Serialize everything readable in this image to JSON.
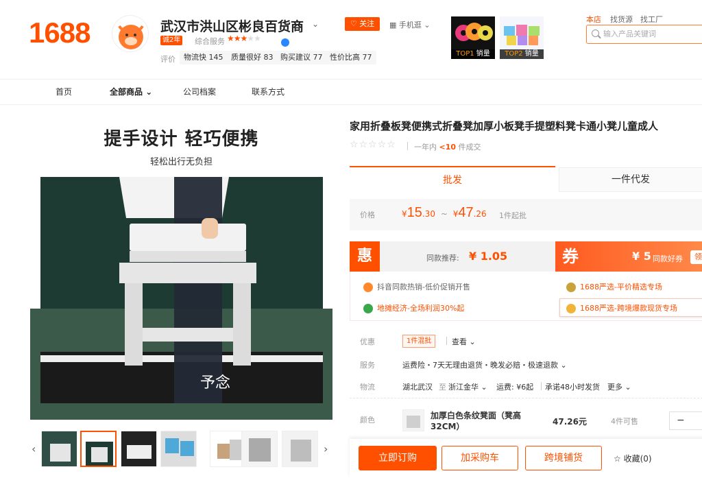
{
  "header": {
    "logo": "1688",
    "shop_name": "武汉市洪山区彬良百货商",
    "year_badge": "诚2年",
    "service_label": "综合服务",
    "service_stars": 3,
    "rating_label": "评价",
    "chips": [
      "物流快 145",
      "质量很好 83",
      "购买建议 77",
      "性价比高 77"
    ],
    "follow": "关注",
    "mobile": "手机逛",
    "top1": {
      "tag": "TOP1",
      "suffix": "销量"
    },
    "top2": {
      "tag": "TOP2",
      "suffix": "销量"
    },
    "search_scopes": [
      "本店",
      "找货源",
      "找工厂"
    ],
    "search_placeholder": "输入产品关键词"
  },
  "nav": [
    "首页",
    "全部商品",
    "公司档案",
    "联系方式"
  ],
  "gallery": {
    "headline": "提手设计 轻巧便携",
    "subline": "轻松出行无负担",
    "brand_mark": "予念"
  },
  "product": {
    "title": "家用折叠板凳便携式折叠凳加厚小板凳手提塑料凳卡通小凳儿童成人",
    "sold_prefix": "一年内",
    "sold_count": "<10",
    "sold_suffix": "件成交",
    "tabs": [
      "批发",
      "一件代发"
    ],
    "price_label": "价格",
    "price_low": {
      "sym": "¥",
      "int": "15",
      "dec": ".30"
    },
    "price_sep": "~",
    "price_high": {
      "sym": "¥",
      "int": "47",
      "dec": ".26"
    },
    "moq": "1件起批",
    "hui": "惠",
    "hui_text": "同款推荐:",
    "hui_price": "¥ 1.05",
    "quan": "券",
    "quan_amount": "¥ 5",
    "quan_text": "同款好券",
    "quan_btn": "领",
    "promos": [
      "抖音同款热销-低价促销开售",
      "1688严选-平价精选专场",
      "地摊经济-全场利润30%起",
      "1688严选-跨境爆款现货专场"
    ],
    "discount_label": "优惠",
    "discount_tag": "1件混批",
    "discount_more": "查看",
    "service_label": "服务",
    "service_text": "运费险・7天无理由退货・晚发必赔・极速退款",
    "logistics_label": "物流",
    "ship_from": "湖北武汉",
    "ship_to_word": "至",
    "ship_to": "浙江金华",
    "ship_fee": "运费: ¥6起",
    "ship_promise": "承诺48小时发货",
    "ship_more": "更多",
    "color_label": "颜色",
    "sku_name": "加厚白色条纹凳面（凳高32CM）",
    "sku_price": "47.26元",
    "sku_stock": "4件可售",
    "stepper_minus": "−",
    "buy": "立即订购",
    "cart": "加采购车",
    "cross": "跨境铺货",
    "fav": "收藏(0)"
  },
  "colors": {
    "brand": "#ff5000"
  }
}
